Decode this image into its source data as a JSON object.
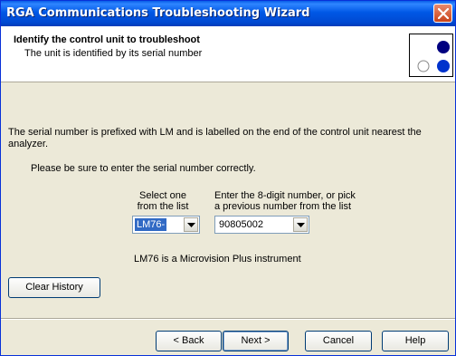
{
  "window": {
    "title": "RGA Communications Troubleshooting Wizard"
  },
  "header": {
    "title": "Identify the control unit to troubleshoot",
    "subtitle": "The unit is identified by its serial number"
  },
  "body": {
    "instruction": "The serial number is prefixed with LM and is labelled on the end of the control unit nearest the analyzer.",
    "reminder": "Please be sure to enter the serial number correctly.",
    "select_label_line1": "Select one",
    "select_label_line2": "from the list",
    "enter_label_line1": "Enter the 8-digit number, or pick",
    "enter_label_line2": "a previous number from the list",
    "prefix_value": "LM76-",
    "serial_value": "90805002",
    "instrument_info": "LM76 is a Microvision Plus instrument",
    "clear_history_label": "Clear History"
  },
  "footer": {
    "back_label": "< Back",
    "next_label": "Next >",
    "cancel_label": "Cancel",
    "help_label": "Help"
  },
  "colors": {
    "titlebar": "#0058e6",
    "selection": "#316ac5",
    "logo_blue": "#0033cc",
    "logo_navy": "#000080"
  },
  "icons": {
    "close": "close-icon",
    "dropdown": "chevron-down-icon",
    "logo": "dots-logo-icon"
  }
}
